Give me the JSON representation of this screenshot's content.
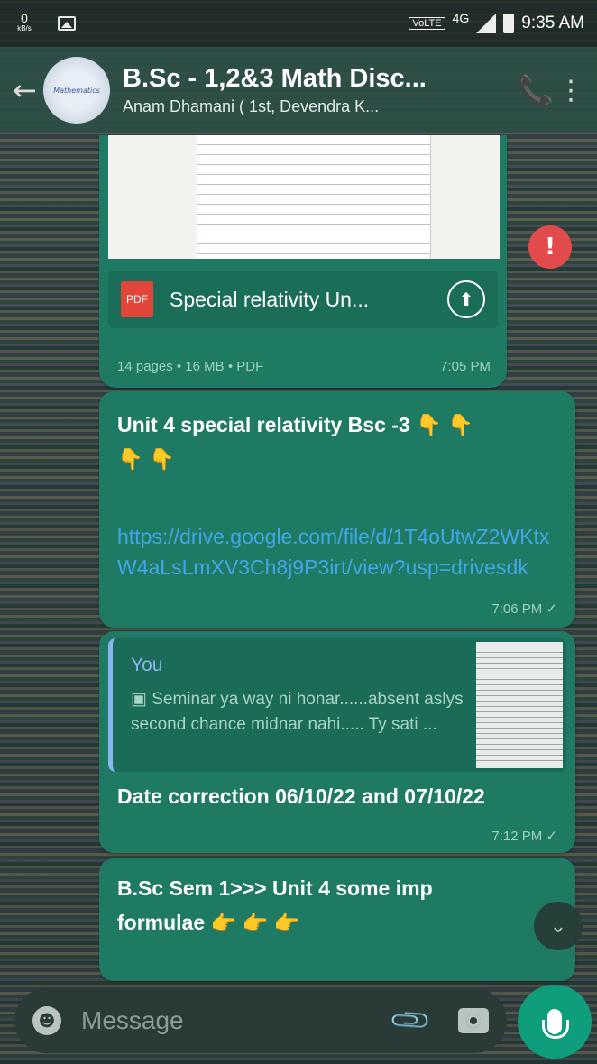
{
  "status_bar": {
    "net_speed": "0",
    "net_speed_unit": "kB/s",
    "volte": "VoLTE",
    "network": "4G",
    "time": "9:35 AM",
    "icons": [
      "gallery-icon",
      "signal-icon",
      "battery-icon"
    ]
  },
  "header": {
    "title": "B.Sc - 1,2&3 Math Disc...",
    "subtitle": "Anam Dhamani ( 1st, Devendra K...",
    "avatar_text": "Mathematics",
    "icons": [
      "back-icon",
      "add-call-icon",
      "more-options-icon"
    ]
  },
  "messages": {
    "document": {
      "file_name": "Special relativity Un...",
      "file_type_badge": "PDF",
      "meta": "14 pages • 16 MB • PDF",
      "time": "7:05 PM"
    },
    "msg1": {
      "text_line1": "Unit 4 special relativity Bsc -3",
      "emoji_row1": "👇 👇",
      "emoji_row2": "👇 👇",
      "link": "https://drive.google.com/file/d/1T4oUtwZ2WKtxW4aLsLmXV3Ch8j9P3irt/view?usp=drivesdk",
      "time": "7:06 PM ✓"
    },
    "msg2": {
      "quote_author": "You",
      "quote_text": "▣ Seminar ya way ni honar......absent aslys second chance midnar nahi..... Ty sati ...",
      "text": "Date correction 06/10/22 and 07/10/22",
      "time": "7:12 PM ✓"
    },
    "msg3": {
      "text_line1": "B.Sc Sem 1>>> Unit 4 some imp",
      "text_line2": "formulae",
      "emojis": "👉 👉 👉"
    }
  },
  "input": {
    "placeholder": "Message"
  },
  "colors": {
    "bubble": "#1f7a63",
    "link": "#42a6e8",
    "mic_button": "#0f9e7b",
    "alert": "#e24b4b"
  }
}
